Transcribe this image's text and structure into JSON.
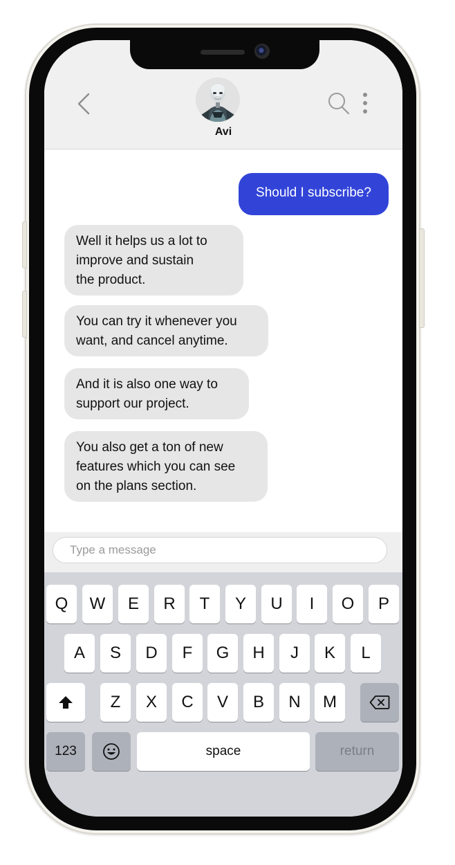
{
  "header": {
    "contact_name": "Avi",
    "back_icon": "chevron-left-icon",
    "search_icon": "search-icon",
    "more_icon": "more-vertical-icon"
  },
  "messages": [
    {
      "direction": "out",
      "text": "Should I subscribe?"
    },
    {
      "direction": "in",
      "text": "Well it helps us a lot to\nimprove and sustain\nthe product."
    },
    {
      "direction": "in",
      "text": "You can try it whenever you\nwant, and cancel anytime."
    },
    {
      "direction": "in",
      "text": "And it is also one way to\nsupport our project."
    },
    {
      "direction": "in",
      "text": "You also get a ton of new\nfeatures which you can see\non the plans section."
    }
  ],
  "composer": {
    "placeholder": "Type a message",
    "value": ""
  },
  "keyboard": {
    "row1": [
      "Q",
      "W",
      "E",
      "R",
      "T",
      "Y",
      "U",
      "I",
      "O",
      "P"
    ],
    "row2": [
      "A",
      "S",
      "D",
      "F",
      "G",
      "H",
      "J",
      "K",
      "L"
    ],
    "row3": [
      "Z",
      "X",
      "C",
      "V",
      "B",
      "N",
      "M"
    ],
    "shift_icon": "shift-arrow-icon",
    "backspace_icon": "backspace-icon",
    "numbers_label": "123",
    "emoji_icon": "emoji-smile-icon",
    "space_label": "space",
    "return_label": "return"
  },
  "colors": {
    "outgoing_bubble": "#3244d8",
    "incoming_bubble": "#e6e6e6",
    "keyboard_bg": "#d2d4d9"
  }
}
